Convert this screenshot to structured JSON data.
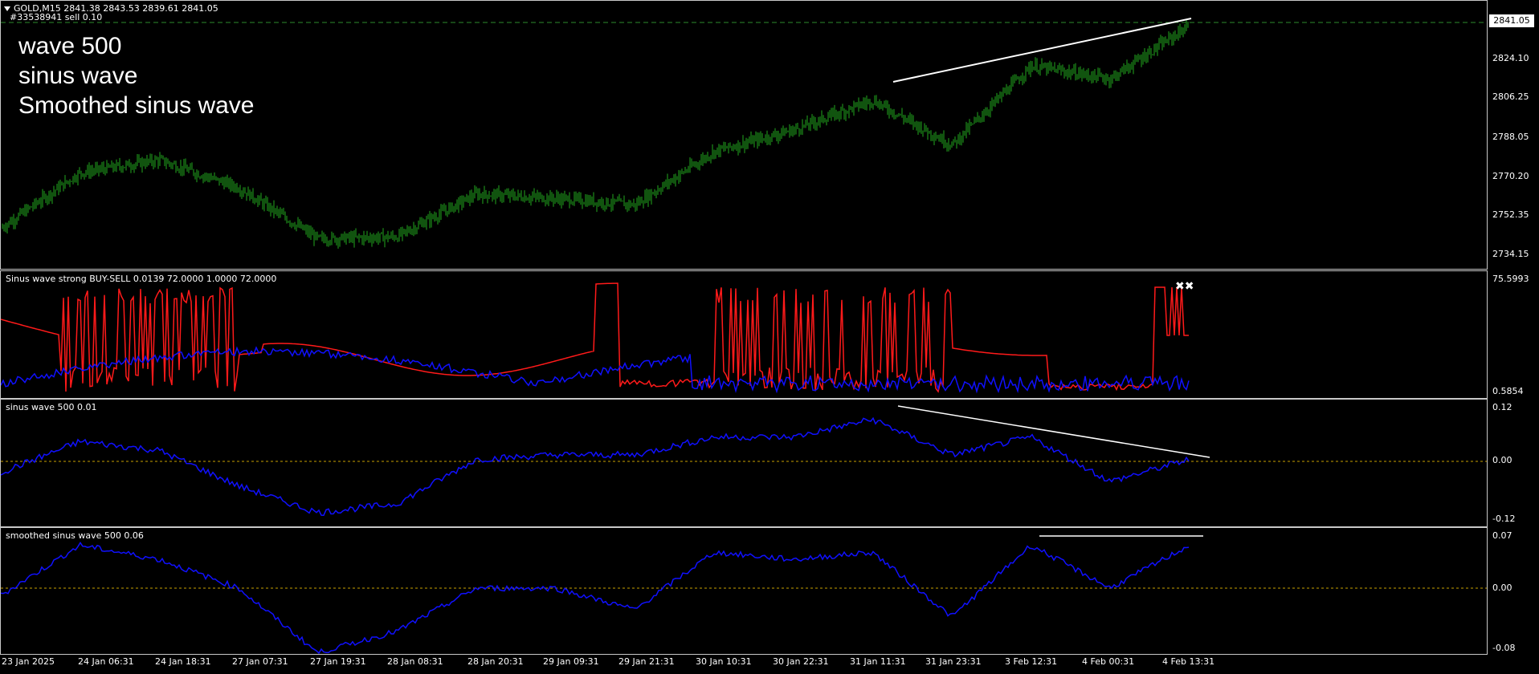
{
  "chart_header": {
    "symbol_ohlc": "GOLD,M15  2841.38 2843.53 2839.61 2841.05",
    "order_line": "#33538941 sell 0.10"
  },
  "overlay_text": [
    "wave 500",
    "sinus wave",
    "Smoothed sinus wave"
  ],
  "panes": {
    "main": {
      "price_labels": [
        "2841.05",
        "2824.10",
        "2806.25",
        "2788.05",
        "2770.20",
        "2752.35",
        "2734.15"
      ],
      "current_price": "2841.05"
    },
    "indicator1": {
      "label": "Sinus wave strong BUY-SELL 0.0139 72.0000 1.0000 72.0000",
      "top_value": "75.5993",
      "bottom_value": "0.5854"
    },
    "indicator2": {
      "label": "sinus wave 500 0.01",
      "levels": [
        "0.12",
        "0.00",
        "-0.12"
      ]
    },
    "indicator3": {
      "label": "smoothed sinus wave 500 0.06",
      "levels": [
        "0.07",
        "0.00",
        "-0.08"
      ]
    }
  },
  "time_axis": [
    "23 Jan 2025",
    "24 Jan 06:31",
    "24 Jan 18:31",
    "27 Jan 07:31",
    "27 Jan 19:31",
    "28 Jan 08:31",
    "28 Jan 20:31",
    "29 Jan 09:31",
    "29 Jan 21:31",
    "30 Jan 10:31",
    "30 Jan 22:31",
    "31 Jan 11:31",
    "31 Jan 23:31",
    "3 Feb 12:31",
    "4 Feb 00:31",
    "4 Feb 13:31"
  ],
  "colors": {
    "price_bars": "#22a81e",
    "red_line": "#ff1a1a",
    "blue_line": "#1010ff",
    "trendline": "#ffffff",
    "zero_level": "#c8a000",
    "bid_line": "#2e8b2e"
  },
  "chart_data": [
    {
      "type": "line",
      "name": "price",
      "x": [
        "23 Jan 2025",
        "24 Jan 06:31",
        "24 Jan 18:31",
        "27 Jan 07:31",
        "27 Jan 19:31",
        "28 Jan 08:31",
        "28 Jan 20:31",
        "29 Jan 09:31",
        "29 Jan 21:31",
        "30 Jan 10:31",
        "30 Jan 22:31",
        "31 Jan 11:31",
        "31 Jan 23:31",
        "3 Feb 12:31",
        "4 Feb 00:31",
        "4 Feb 13:31"
      ],
      "y": [
        2746,
        2772,
        2778,
        2765,
        2741,
        2742,
        2762,
        2760,
        2757,
        2782,
        2792,
        2806,
        2785,
        2822,
        2816,
        2841
      ],
      "ylim": [
        2730,
        2845
      ]
    },
    {
      "type": "line",
      "name": "sinus wave 500",
      "y": [
        -0.02,
        0.05,
        0.03,
        -0.05,
        -0.11,
        -0.09,
        0.01,
        0.02,
        0.02,
        0.06,
        0.06,
        0.1,
        0.02,
        0.06,
        -0.04,
        0.01
      ],
      "ylim": [
        -0.13,
        0.13
      ]
    },
    {
      "type": "line",
      "name": "smoothed sinus wave 500",
      "y": [
        -0.01,
        0.06,
        0.04,
        0.0,
        -0.09,
        -0.06,
        0.0,
        0.0,
        -0.03,
        0.05,
        0.04,
        0.05,
        -0.04,
        0.06,
        0.0,
        0.06
      ],
      "ylim": [
        -0.085,
        0.075
      ]
    }
  ]
}
